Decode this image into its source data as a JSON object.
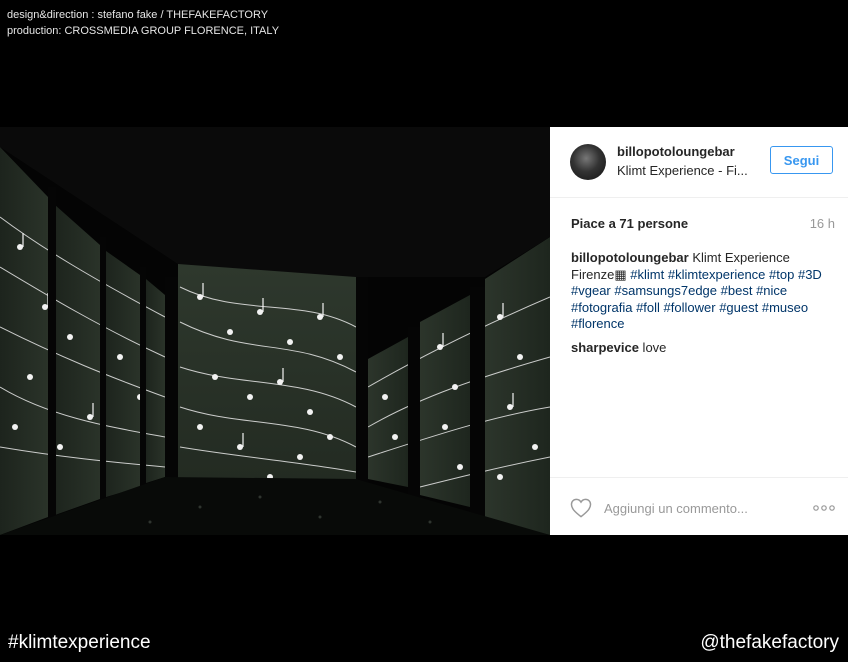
{
  "credits": {
    "line1": "design&direction : stefano fake / THEFAKEFACTORY",
    "line2": "production: CROSSMEDIA GROUP FLORENCE, ITALY"
  },
  "post": {
    "photo_alt": "photo",
    "username": "billopotoloungebar",
    "location": "Klimt Experience - Fi...",
    "follow_label": "Segui",
    "likes": "Piace a 71 persone",
    "time": "16 h",
    "caption": {
      "user": "billopotoloungebar",
      "text": " Klimt Experience Firenze",
      "emoji": "▦",
      "tags": [
        "#klimt",
        "#klimtexperience",
        "#top",
        "#3D",
        "#vgear",
        "#samsungs7edge",
        "#best",
        "#nice",
        "#fotografia",
        "#foll",
        "#follower",
        "#guest",
        "#museo",
        "#florence"
      ]
    },
    "comment": {
      "user": "sharpevice",
      "text": " love"
    },
    "comment_placeholder": "Aggiungi un commento...",
    "accent_color": "#3897f0"
  },
  "footer": {
    "left_tag": "#klimtexperience",
    "right_tag": "@thefakefactory"
  }
}
